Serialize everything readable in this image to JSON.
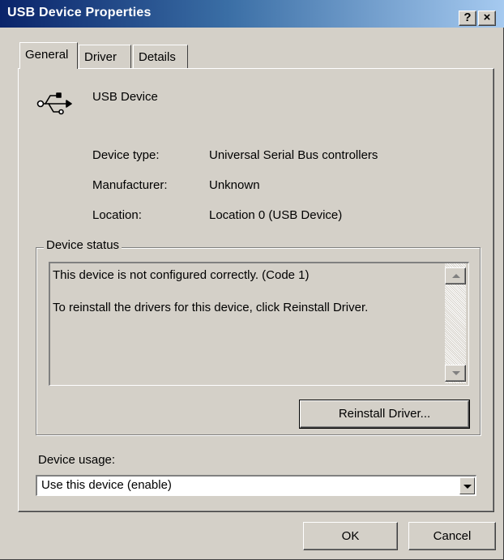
{
  "window": {
    "title": "USB Device Properties",
    "help_label": "?",
    "close_label": "×"
  },
  "tabs": [
    {
      "label": "General",
      "active": true
    },
    {
      "label": "Driver",
      "active": false
    },
    {
      "label": "Details",
      "active": false
    }
  ],
  "device": {
    "icon": "usb-icon",
    "name": "USB Device",
    "properties": [
      {
        "label": "Device type:",
        "value": "Universal Serial Bus controllers"
      },
      {
        "label": "Manufacturer:",
        "value": "Unknown"
      },
      {
        "label": "Location:",
        "value": "Location 0 (USB Device)"
      }
    ]
  },
  "status": {
    "group_title": "Device status",
    "lines": [
      "This device is not configured correctly. (Code 1)",
      "To reinstall the drivers for this device, click Reinstall Driver."
    ],
    "reinstall_label": "Reinstall Driver..."
  },
  "usage": {
    "label": "Device usage:",
    "selected": "Use this device (enable)"
  },
  "footer": {
    "ok_label": "OK",
    "cancel_label": "Cancel"
  },
  "colors": {
    "face": "#d4d0c8",
    "title_start": "#0a246a",
    "title_end": "#a6caf0"
  }
}
